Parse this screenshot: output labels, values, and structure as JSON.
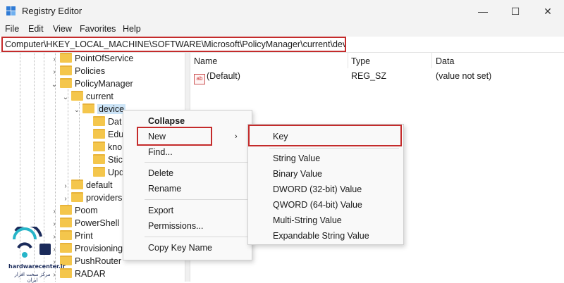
{
  "window": {
    "title": "Registry Editor"
  },
  "menubar": [
    "File",
    "Edit",
    "View",
    "Favorites",
    "Help"
  ],
  "address": "Computer\\HKEY_LOCAL_MACHINE\\SOFTWARE\\Microsoft\\PolicyManager\\current\\device",
  "tree": {
    "pointofservice": "PointOfService",
    "policies": "Policies",
    "policymanager": "PolicyManager",
    "current": "current",
    "device": "device",
    "dat": "Dat",
    "edu": "Edu",
    "kno": "kno",
    "stic": "Stic",
    "upd": "Upd",
    "default": "default",
    "providers": "providers",
    "poom": "Poom",
    "powershell": "PowerShell",
    "print": "Print",
    "provisioning": "Provisioning",
    "pushrouter": "PushRouter",
    "radar": "RADAR"
  },
  "list": {
    "col_name": "Name",
    "col_type": "Type",
    "col_data": "Data",
    "row_name": "(Default)",
    "row_type": "REG_SZ",
    "row_data": "(value not set)"
  },
  "context_menu": {
    "collapse": "Collapse",
    "new": "New",
    "find": "Find...",
    "delete": "Delete",
    "rename": "Rename",
    "export": "Export",
    "permissions": "Permissions...",
    "copy_key_name": "Copy Key Name"
  },
  "submenu": {
    "key": "Key",
    "string_value": "String Value",
    "binary_value": "Binary Value",
    "dword_value": "DWORD (32-bit) Value",
    "qword_value": "QWORD (64-bit) Value",
    "multi_string": "Multi-String Value",
    "expandable_string": "Expandable String Value"
  },
  "watermark": {
    "site": "hardwarecenter.ir",
    "tagline": "مرکز سخت افزار ایران"
  },
  "colors": {
    "highlight": "#c42b2b",
    "folder": "#f4c64c",
    "selection": "#cce4f7"
  }
}
